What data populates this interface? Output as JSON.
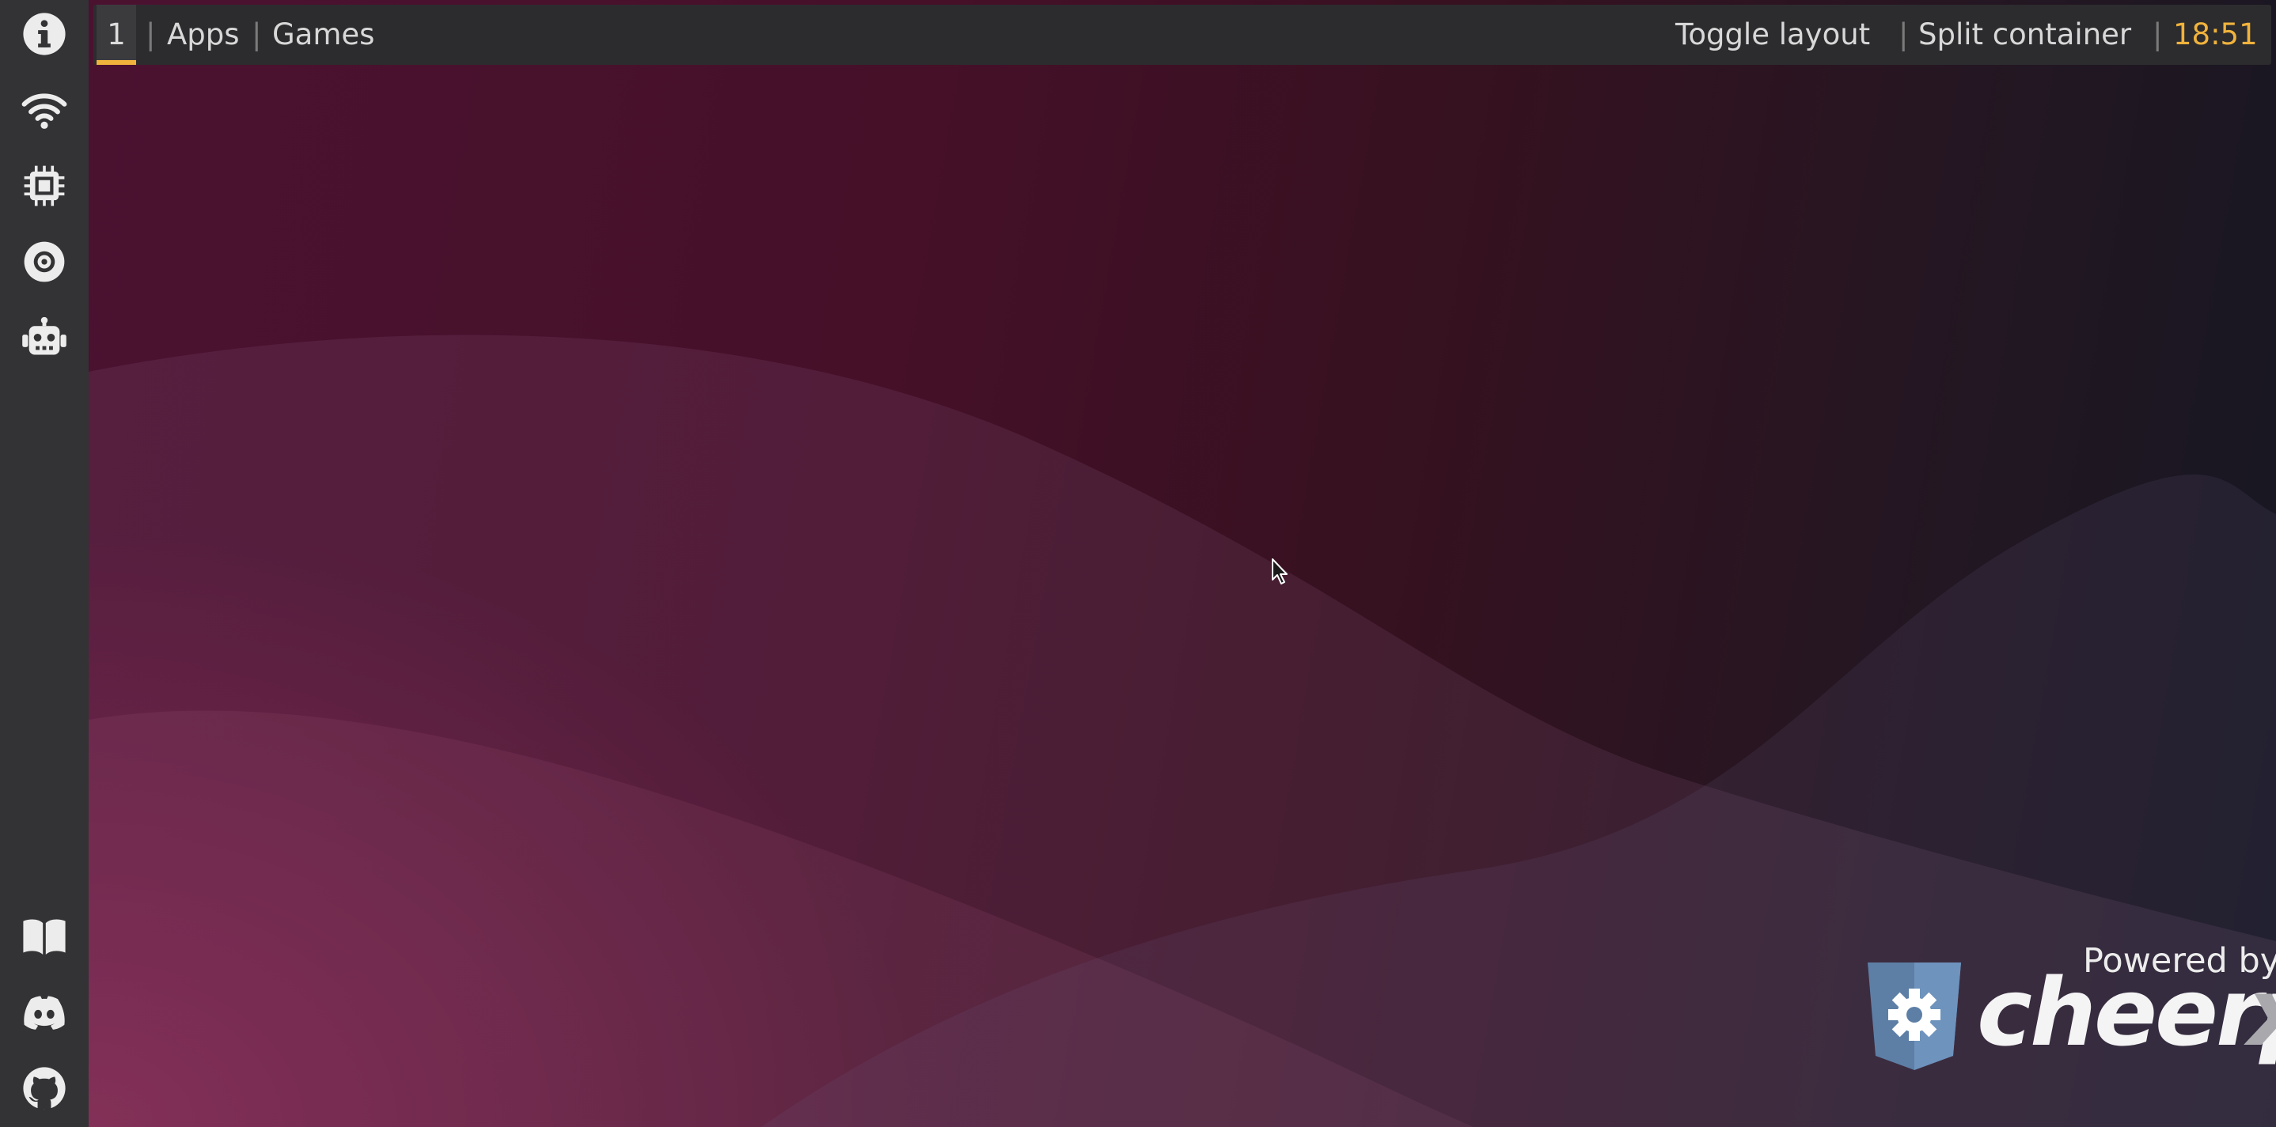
{
  "sidebar": {
    "top_items": [
      {
        "icon": "info-icon"
      },
      {
        "icon": "wifi-icon"
      },
      {
        "icon": "cpu-icon"
      },
      {
        "icon": "disk-icon"
      },
      {
        "icon": "robot-icon"
      }
    ],
    "bottom_items": [
      {
        "icon": "book-icon"
      },
      {
        "icon": "discord-icon"
      },
      {
        "icon": "github-icon"
      }
    ]
  },
  "topbar": {
    "workspace": "1",
    "separator": "|",
    "apps_label": "Apps",
    "games_label": "Games",
    "toggle_layout_label": "Toggle layout",
    "split_container_label": "Split container",
    "clock": "18:51"
  },
  "branding": {
    "powered_by": "Powered by",
    "name_main": "cheerp",
    "name_suffix": "x"
  },
  "colors": {
    "accent": "#f0b33c",
    "sidebar_bg": "#333335",
    "topbar_bg": "#2c2c2e",
    "wallpaper_left": "#4b1230",
    "wallpaper_right": "#151722"
  }
}
